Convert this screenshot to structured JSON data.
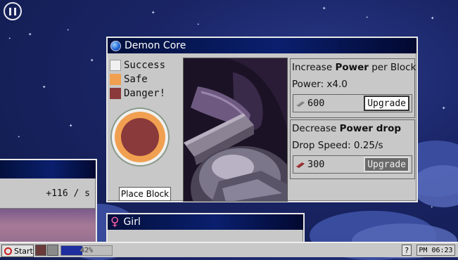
{
  "demon_core": {
    "title": "Demon Core",
    "legend": [
      {
        "label": "Success",
        "color": "#f0f0f0"
      },
      {
        "label": "Safe",
        "color": "#f0a050"
      },
      {
        "label": "Danger!",
        "color": "#8a3a3a"
      }
    ],
    "place_block_label": "Place Block",
    "power_panel": {
      "title_pre": "Increase ",
      "title_bold": "Power",
      "title_post": " per Block",
      "stat": "Power: x4.0",
      "cost": "600",
      "upgrade_label": "Upgrade",
      "upgrade_enabled": true
    },
    "drop_panel": {
      "title_pre": "Decrease ",
      "title_bold": "Power drop",
      "stat": "Drop Speed: 0.25/s",
      "cost": "300",
      "upgrade_label": "Upgrade",
      "upgrade_enabled": false
    }
  },
  "left_window": {
    "title": "",
    "rate": "+116 / s"
  },
  "girl_window": {
    "title": "Girl"
  },
  "taskbar": {
    "start_label": "Start",
    "progress_text": "42%",
    "progress_value": 0.42,
    "help_label": "?",
    "clock": "PM 06:23"
  },
  "icons": {
    "pause": "pause-icon",
    "orb": "orb-icon",
    "female": "female-symbol-icon",
    "power": "power-icon",
    "help": "help-icon"
  }
}
